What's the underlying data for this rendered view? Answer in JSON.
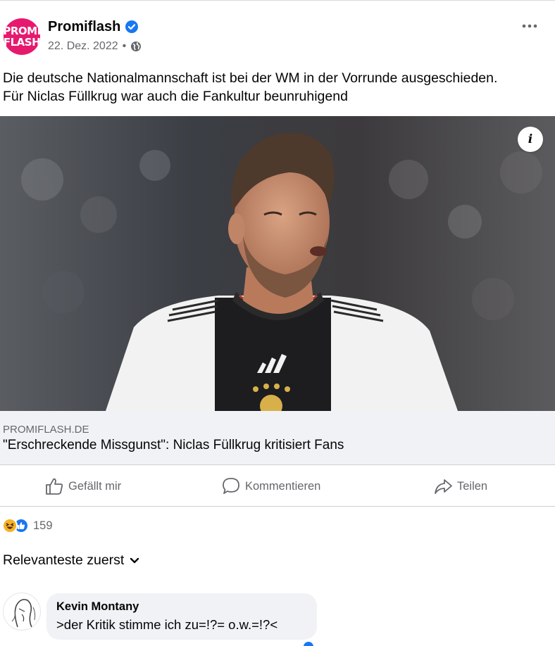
{
  "post": {
    "page_name": "Promiflash",
    "avatar_text_line1": "PROMI",
    "avatar_text_line2": "FLASH",
    "date": "22. Dez. 2022",
    "separator": "•",
    "verified_icon": "verified-badge-icon",
    "privacy_icon": "globe-icon",
    "more_icon": "more-options-icon",
    "text_line1": "Die deutsche Nationalmannschaft ist bei der WM in der Vorrunde ausgeschieden.",
    "text_line2": "Für Niclas Füllkrug war auch die Fankultur beunruhigend",
    "info_label": "i"
  },
  "link_preview": {
    "domain": "PROMIFLASH.DE",
    "title": "\"Erschreckende Missgunst\": Niclas Füllkrug kritisiert Fans"
  },
  "actions": {
    "like": "Gefällt mir",
    "comment": "Kommentieren",
    "share": "Teilen"
  },
  "reactions": {
    "count": "159",
    "icons": [
      "haha-reaction-icon",
      "like-reaction-icon"
    ]
  },
  "comments": {
    "sort_label": "Relevanteste zuerst",
    "items": [
      {
        "author": "Kevin Montany",
        "text": ">der Kritik stimme ich zu=!?= o.w.=!?<"
      }
    ]
  },
  "colors": {
    "brand_blue": "#1877f2",
    "promiflash_pink": "#e6196f",
    "secondary_text": "#65676b",
    "card_bg": "#f0f2f5"
  }
}
